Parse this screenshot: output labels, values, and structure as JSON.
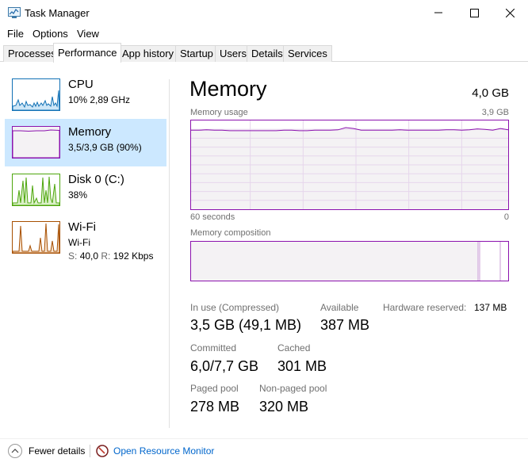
{
  "window": {
    "title": "Task Manager"
  },
  "menu": [
    "File",
    "Options",
    "View"
  ],
  "tabs": [
    "Processes",
    "Performance",
    "App history",
    "Startup",
    "Users",
    "Details",
    "Services"
  ],
  "active_tab": "Performance",
  "sidebar": {
    "items": [
      {
        "title": "CPU",
        "sub": "10% 2,89 GHz",
        "color": "#1171b5"
      },
      {
        "title": "Memory",
        "sub": "3,5/3,9 GB (90%)",
        "color": "#8b12ae",
        "selected": true
      },
      {
        "title": "Disk 0 (C:)",
        "sub": "38%",
        "color": "#4da60c"
      },
      {
        "title": "Wi-Fi",
        "sub": "Wi-Fi",
        "sub2_s_label": "S:",
        "sub2_s_value": "40,0",
        "sub2_r_label": "R:",
        "sub2_r_value": "192 Kbps",
        "color": "#a74f01"
      }
    ]
  },
  "main": {
    "title": "Memory",
    "total": "4,0 GB",
    "usage_label": "Memory usage",
    "usage_max": "3,9 GB",
    "time_left": "60 seconds",
    "time_right": "0",
    "composition_label": "Memory composition",
    "composition": {
      "in_use_fraction": 0.905,
      "modified_fraction": 0.005,
      "standby_fraction": 0.065,
      "free_fraction": 0.025
    },
    "usage_series_percent": [
      89,
      89,
      89.5,
      89,
      89,
      88.5,
      88.5,
      88.5,
      88.5,
      88.5,
      88.5,
      88.5,
      89,
      89,
      88.5,
      88.5,
      89,
      89,
      89,
      89.5,
      92,
      91,
      89,
      89,
      89,
      89,
      89,
      89.5,
      89,
      89,
      89,
      89,
      89,
      89.5,
      89.5,
      89,
      89.5,
      90.5,
      90,
      89,
      91,
      89.5
    ],
    "accent": "#8b12ae",
    "stats": {
      "in_use_label": "In use (Compressed)",
      "in_use_value": "3,5 GB (49,1 MB)",
      "available_label": "Available",
      "available_value": "387 MB",
      "hw_reserved_label": "Hardware reserved:",
      "hw_reserved_value": "137 MB",
      "committed_label": "Committed",
      "committed_value": "6,0/7,7 GB",
      "cached_label": "Cached",
      "cached_value": "301 MB",
      "paged_label": "Paged pool",
      "paged_value": "278 MB",
      "nonpaged_label": "Non-paged pool",
      "nonpaged_value": "320 MB"
    }
  },
  "footer": {
    "fewer_details": "Fewer details",
    "open_resmon": "Open Resource Monitor"
  }
}
